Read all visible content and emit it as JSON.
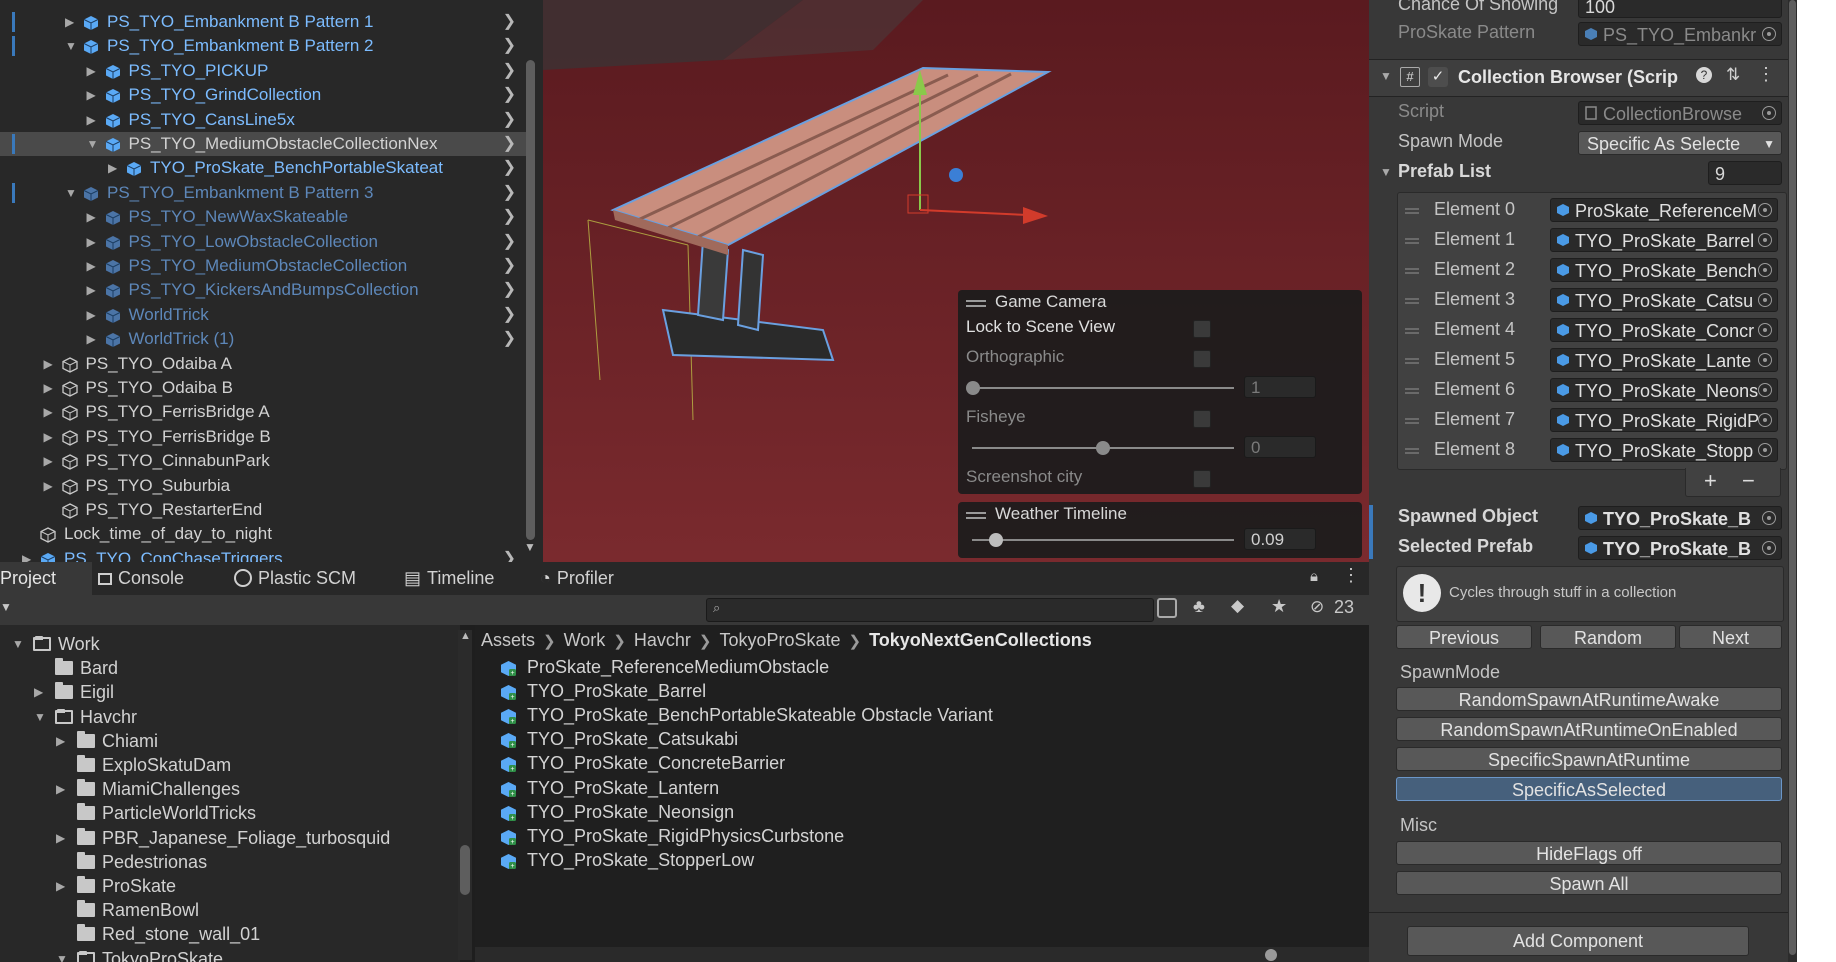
{
  "hierarchy": {
    "items": [
      {
        "label": "PS_TYO_Embankment B Pattern 1",
        "depth": 2,
        "expanded": false,
        "style": "blue",
        "chevron": true,
        "marked": true
      },
      {
        "label": "PS_TYO_Embankment B Pattern 2",
        "depth": 2,
        "expanded": true,
        "style": "blue",
        "chevron": true,
        "marked": true
      },
      {
        "label": "PS_TYO_PICKUP",
        "depth": 3,
        "expanded": false,
        "style": "blue",
        "chevron": true
      },
      {
        "label": "PS_TYO_GrindCollection",
        "depth": 3,
        "expanded": false,
        "style": "blue",
        "chevron": true
      },
      {
        "label": "PS_TYO_CansLine5x",
        "depth": 3,
        "expanded": false,
        "style": "blue",
        "chevron": true
      },
      {
        "label": "PS_TYO_MediumObstacleCollectionNex",
        "depth": 3,
        "expanded": true,
        "style": "grey",
        "chevron": true,
        "selected": true,
        "marked": true
      },
      {
        "label": "TYO_ProSkate_BenchPortableSkateat",
        "depth": 4,
        "expanded": false,
        "style": "blue",
        "chevron": true
      },
      {
        "label": "PS_TYO_Embankment B Pattern 3",
        "depth": 2,
        "expanded": true,
        "style": "dim",
        "chevron": true,
        "marked": true
      },
      {
        "label": "PS_TYO_NewWaxSkateable",
        "depth": 3,
        "expanded": false,
        "style": "dim",
        "chevron": true
      },
      {
        "label": "PS_TYO_LowObstacleCollection",
        "depth": 3,
        "expanded": false,
        "style": "dim",
        "chevron": true
      },
      {
        "label": "PS_TYO_MediumObstacleCollection",
        "depth": 3,
        "expanded": false,
        "style": "dim",
        "chevron": true
      },
      {
        "label": "PS_TYO_KickersAndBumpsCollection",
        "depth": 3,
        "expanded": false,
        "style": "dim",
        "chevron": true
      },
      {
        "label": "WorldTrick",
        "depth": 3,
        "expanded": false,
        "style": "dim",
        "chevron": true
      },
      {
        "label": "WorldTrick (1)",
        "depth": 3,
        "expanded": false,
        "style": "dim",
        "chevron": true
      },
      {
        "label": "PS_TYO_Odaiba A",
        "depth": 1,
        "expanded": false,
        "style": "grey",
        "chevron": false
      },
      {
        "label": "PS_TYO_Odaiba B",
        "depth": 1,
        "expanded": false,
        "style": "grey",
        "chevron": false
      },
      {
        "label": "PS_TYO_FerrisBridge A",
        "depth": 1,
        "expanded": false,
        "style": "grey",
        "chevron": false
      },
      {
        "label": "PS_TYO_FerrisBridge B",
        "depth": 1,
        "expanded": false,
        "style": "grey",
        "chevron": false
      },
      {
        "label": "PS_TYO_CinnabunPark",
        "depth": 1,
        "expanded": false,
        "style": "grey",
        "chevron": false
      },
      {
        "label": "PS_TYO_Suburbia",
        "depth": 1,
        "expanded": false,
        "style": "grey",
        "chevron": false
      },
      {
        "label": "PS_TYO_RestarterEnd",
        "depth": 1,
        "expanded": null,
        "style": "grey",
        "chevron": false
      },
      {
        "label": "Lock_time_of_day_to_night",
        "depth": 0,
        "expanded": null,
        "style": "grey",
        "chevron": false
      },
      {
        "label": "PS_TYO_CopChaseTriggers",
        "depth": 0,
        "expanded": false,
        "style": "blue",
        "chevron": true
      }
    ]
  },
  "scene": {
    "game_camera": {
      "title": "Game Camera",
      "lock_label": "Lock to Scene View",
      "ortho_label": "Orthographic",
      "ortho_value": "1",
      "fisheye_label": "Fisheye",
      "fisheye_value": "0",
      "fisheye_level": 0.5,
      "screenshot_label": "Screenshot city"
    },
    "weather": {
      "title": "Weather Timeline",
      "value": "0.09",
      "level": 0.09
    }
  },
  "tabs": [
    "Project",
    "Console",
    "Plastic SCM",
    "Timeline",
    "Profiler"
  ],
  "toolbar": {
    "hidden_count": "23"
  },
  "folders": [
    {
      "label": "Work",
      "indent": 0,
      "arrow": "open",
      "open": true
    },
    {
      "label": "Bard",
      "indent": 1,
      "arrow": "none"
    },
    {
      "label": "Eigil",
      "indent": 1,
      "arrow": "closed"
    },
    {
      "label": "Havchr",
      "indent": 1,
      "arrow": "open",
      "open": true
    },
    {
      "label": "Chiami",
      "indent": 2,
      "arrow": "closed"
    },
    {
      "label": "ExploSkatuDam",
      "indent": 2,
      "arrow": "none"
    },
    {
      "label": "MiamiChallenges",
      "indent": 2,
      "arrow": "closed"
    },
    {
      "label": "ParticleWorldTricks",
      "indent": 2,
      "arrow": "none"
    },
    {
      "label": "PBR_Japanese_Foliage_turbosquid",
      "indent": 2,
      "arrow": "closed"
    },
    {
      "label": "Pedestrionas",
      "indent": 2,
      "arrow": "none"
    },
    {
      "label": "ProSkate",
      "indent": 2,
      "arrow": "closed"
    },
    {
      "label": "RamenBowl",
      "indent": 2,
      "arrow": "none"
    },
    {
      "label": "Red_stone_wall_01",
      "indent": 2,
      "arrow": "none"
    },
    {
      "label": "TokyoProSkate",
      "indent": 2,
      "arrow": "open",
      "open": true
    }
  ],
  "breadcrumb": [
    "Assets",
    "Work",
    "Havchr",
    "TokyoProSkate",
    "TokyoNextGenCollections"
  ],
  "assets": [
    "ProSkate_ReferenceMediumObstacle",
    "TYO_ProSkate_Barrel",
    "TYO_ProSkate_BenchPortableSkateable Obstacle Variant",
    "TYO_ProSkate_Catsukabi",
    "TYO_ProSkate_ConcreteBarrier",
    "TYO_ProSkate_Lantern",
    "TYO_ProSkate_Neonsign",
    "TYO_ProSkate_RigidPhysicsCurbstone",
    "TYO_ProSkate_StopperLow"
  ],
  "inspector": {
    "chance_label": "Chance Of Showing",
    "chance_value": "100",
    "pattern_label": "ProSkate Pattern",
    "pattern_value": "PS_TYO_Embankr",
    "component_title": "Collection Browser (Scrip",
    "script_label": "Script",
    "script_value": "CollectionBrowse",
    "spawn_mode_label": "Spawn Mode",
    "spawn_mode_value": "Specific As Selecte",
    "prefab_list_label": "Prefab List",
    "prefab_list_count": "9",
    "elements": [
      {
        "label": "Element 0",
        "value": "ProSkate_ReferenceM"
      },
      {
        "label": "Element 1",
        "value": "TYO_ProSkate_Barrel"
      },
      {
        "label": "Element 2",
        "value": "TYO_ProSkate_Bench"
      },
      {
        "label": "Element 3",
        "value": "TYO_ProSkate_Catsu"
      },
      {
        "label": "Element 4",
        "value": "TYO_ProSkate_Concr"
      },
      {
        "label": "Element 5",
        "value": "TYO_ProSkate_Lante"
      },
      {
        "label": "Element 6",
        "value": "TYO_ProSkate_Neons"
      },
      {
        "label": "Element 7",
        "value": "TYO_ProSkate_RigidP"
      },
      {
        "label": "Element 8",
        "value": "TYO_ProSkate_Stopp"
      }
    ],
    "add_label": "+",
    "remove_label": "−",
    "spawned_label": "Spawned Object",
    "spawned_value": "TYO_ProSkate_B",
    "selected_label": "Selected Prefab",
    "selected_value": "TYO_ProSkate_B",
    "help_text": "Cycles through stuff in a collection",
    "nav_buttons": [
      "Previous",
      "Random",
      "Next"
    ],
    "spawnmode_header": "SpawnMode",
    "spawnmode_buttons": [
      "RandomSpawnAtRuntimeAwake",
      "RandomSpawnAtRuntimeOnEnabled",
      "SpecificSpawnAtRuntime",
      "SpecificAsSelected"
    ],
    "spawnmode_selected": 3,
    "misc_header": "Misc",
    "misc_buttons": [
      "HideFlags off",
      "Spawn All"
    ],
    "add_component": "Add Component"
  },
  "colors": {
    "prefab_blue": "#7cbcff",
    "prefab_blue_dim": "#5d87b9",
    "scene_red": "#6b2227",
    "selected_button": "#46607c"
  }
}
